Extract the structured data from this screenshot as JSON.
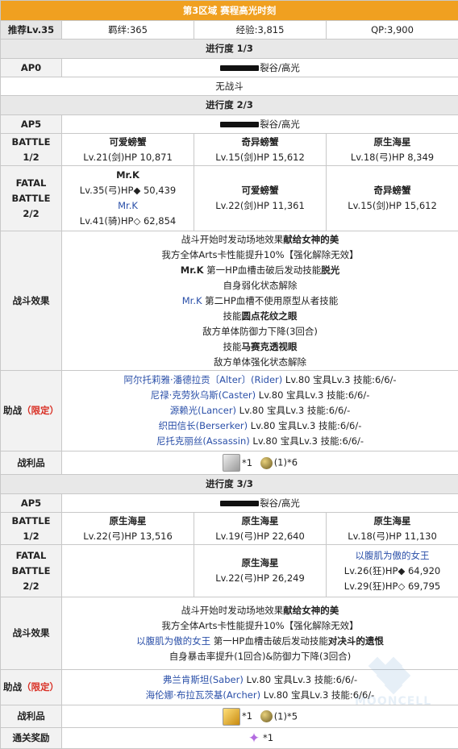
{
  "title": "第3区域 赛程高光时刻",
  "header": {
    "level": "推荐Lv.35",
    "bond": "羁绊:365",
    "exp": "经验:3,815",
    "qp": "QP:3,900"
  },
  "stage1": {
    "label": "进行度 1/3",
    "ap_label": "AP0",
    "location": "裂谷/高光",
    "no_battle": "无战斗"
  },
  "stage2": {
    "label": "进行度 2/3",
    "ap_label": "AP5",
    "location": "裂谷/高光",
    "battle1_label": [
      "BATTLE",
      "1/2"
    ],
    "battle1": [
      {
        "name": "可爱螃蟹",
        "stats": "Lv.21(剑)HP 10,871"
      },
      {
        "name": "奇异螃蟹",
        "stats": "Lv.15(剑)HP 15,612"
      },
      {
        "name": "原生海星",
        "stats": "Lv.18(弓)HP 8,349"
      }
    ],
    "battle2_label": [
      "FATAL",
      "BATTLE",
      "2/2"
    ],
    "battle2_col1": {
      "name1": "Mr.K",
      "stats1": "Lv.35(弓)HP◆ 50,439",
      "name2": "Mr.K",
      "stats2": "Lv.41(骑)HP◇ 62,854"
    },
    "battle2": [
      {
        "name": "可爱螃蟹",
        "stats": "Lv.22(剑)HP 11,361"
      },
      {
        "name": "奇异螃蟹",
        "stats": "Lv.15(剑)HP 15,612"
      }
    ],
    "effects_label": "战斗效果",
    "effects": {
      "e1a": "战斗开始时发动场地效果",
      "e1b": "献给女神的美",
      "e2": "我方全体Arts卡性能提升10%【强化解除无效】",
      "e3a": "Mr.K",
      "e3b": " 第一HP血槽击破后发动技能",
      "e3c": "脱光",
      "e4": "自身弱化状态解除",
      "e5a": "Mr.K",
      "e5b": " 第二HP血槽不使用原型从者技能",
      "e6a": "技能",
      "e6b": "圆点花纹之眼",
      "e7": "敌方单体防御力下降(3回合)",
      "e8a": "技能",
      "e8b": "马赛克透视眼",
      "e9": "敌方单体强化状态解除"
    },
    "support_label": "助战",
    "support_paren_open": "（",
    "support_limited": "限定",
    "support_paren_close": "）",
    "supports": [
      {
        "name": "阿尔托莉雅·潘德拉贡〔Alter〕(Rider)",
        "info": " Lv.80 宝具Lv.3 技能:6/6/-"
      },
      {
        "name": "尼禄·克劳狄乌斯(Caster)",
        "info": " Lv.80 宝具Lv.3 技能:6/6/-"
      },
      {
        "name": "源赖光(Lancer)",
        "info": " Lv.80 宝具Lv.3 技能:6/6/-"
      },
      {
        "name": "织田信长(Berserker)",
        "info": " Lv.80 宝具Lv.3 技能:6/6/-"
      },
      {
        "name": "尼托克丽丝(Assassin)",
        "info": " Lv.80 宝具Lv.3 技能:6/6/-"
      }
    ],
    "loot_label": "战利品",
    "loot1_count": "*1",
    "loot2_count": "(1)*6"
  },
  "stage3": {
    "label": "进行度 3/3",
    "ap_label": "AP5",
    "location": "裂谷/高光",
    "battle1_label": [
      "BATTLE",
      "1/2"
    ],
    "battle1": [
      {
        "name": "原生海星",
        "stats": "Lv.22(弓)HP 13,516"
      },
      {
        "name": "原生海星",
        "stats": "Lv.19(弓)HP 22,640"
      },
      {
        "name": "原生海星",
        "stats": "Lv.18(弓)HP 11,130"
      }
    ],
    "battle2_label": [
      "FATAL",
      "BATTLE",
      "2/2"
    ],
    "battle2_mid": {
      "name": "原生海星",
      "stats": "Lv.22(弓)HP 26,249"
    },
    "battle2_right": {
      "name": "以腹肌为傲的女王",
      "stats1": "Lv.26(狂)HP◆ 64,920",
      "stats2": "Lv.29(狂)HP◇ 69,795"
    },
    "effects_label": "战斗效果",
    "effects": {
      "e1a": "战斗开始时发动场地效果",
      "e1b": "献给女神的美",
      "e2": "我方全体Arts卡性能提升10%【强化解除无效】",
      "e3a": "以腹肌为傲的女王",
      "e3b": " 第一HP血槽击破后发动技能",
      "e3c": "对决斗的遗恨",
      "e4": "自身暴击率提升(1回合)&防御力下降(3回合)"
    },
    "support_label": "助战",
    "support_paren_open": "（",
    "support_limited": "限定",
    "support_paren_close": "）",
    "supports": [
      {
        "name": "弗兰肯斯坦(Saber)",
        "info": " Lv.80 宝具Lv.3 技能:6/6/-"
      },
      {
        "name": "海伦娜·布拉瓦茨基(Archer)",
        "info": " Lv.80 宝具Lv.3 技能:6/6/-"
      }
    ],
    "loot_label": "战利品",
    "loot1_count": "*1",
    "loot2_count": "(1)*5",
    "clear_label": "通关奖励",
    "clear_count": "*1"
  },
  "watermark": "MOONCELL"
}
